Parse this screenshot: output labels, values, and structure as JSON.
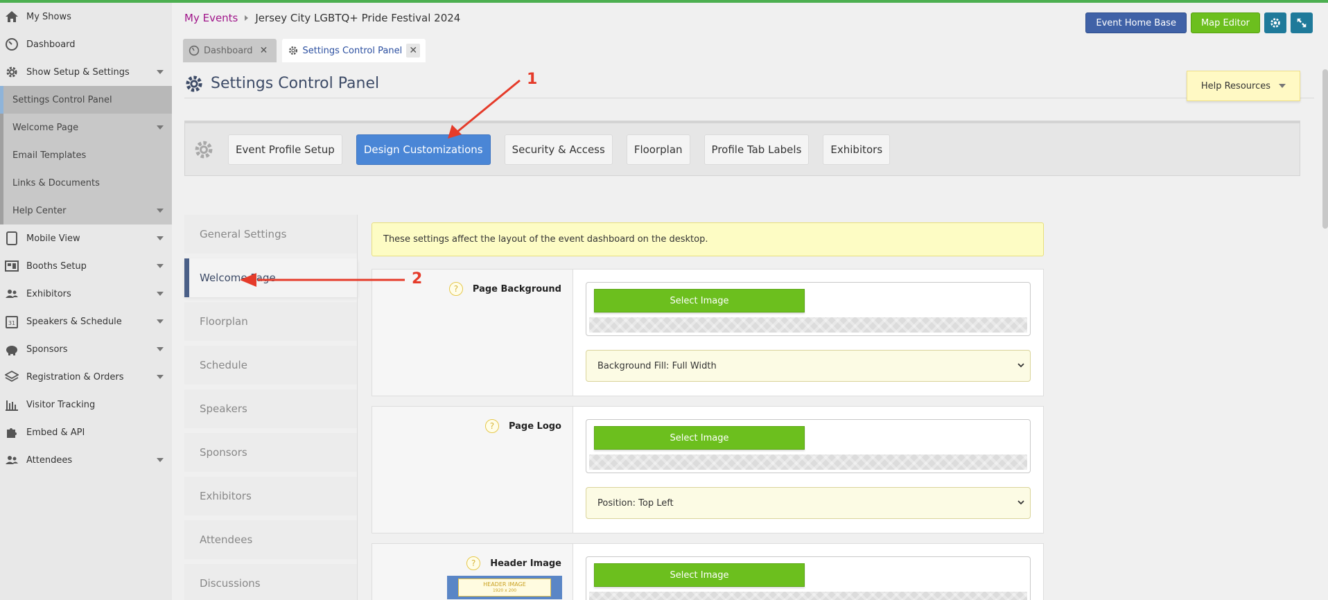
{
  "sidebar": {
    "items": [
      {
        "label": "My Shows",
        "icon": "home-icon"
      },
      {
        "label": "Dashboard",
        "icon": "gauge-icon"
      },
      {
        "label": "Show Setup & Settings",
        "icon": "gear-icon"
      },
      {
        "label": "Mobile View",
        "icon": "tablet-icon"
      },
      {
        "label": "Booths Setup",
        "icon": "layout-icon"
      },
      {
        "label": "Exhibitors",
        "icon": "users-icon"
      },
      {
        "label": "Speakers & Schedule",
        "icon": "calendar-icon"
      },
      {
        "label": "Sponsors",
        "icon": "piggy-bank-icon"
      },
      {
        "label": "Registration & Orders",
        "icon": "layers-icon"
      },
      {
        "label": "Visitor Tracking",
        "icon": "bar-chart-icon"
      },
      {
        "label": "Embed & API",
        "icon": "puzzle-icon"
      },
      {
        "label": "Attendees",
        "icon": "users-icon"
      }
    ],
    "submenu": [
      {
        "label": "Settings Control Panel"
      },
      {
        "label": "Welcome Page"
      },
      {
        "label": "Email Templates"
      },
      {
        "label": "Links & Documents"
      },
      {
        "label": "Help Center"
      }
    ],
    "calendar_day": "31"
  },
  "breadcrumb": {
    "link": "My Events",
    "current": "Jersey City LGBTQ+ Pride Festival 2024"
  },
  "top_buttons": {
    "event_home_base": "Event Home Base",
    "map_editor": "Map Editor"
  },
  "tabs": [
    {
      "label": "Dashboard",
      "close": "✕"
    },
    {
      "label": "Settings Control Panel",
      "close": "✕"
    }
  ],
  "page": {
    "title": "Settings Control Panel",
    "help_resources": "Help Resources"
  },
  "settings_tabs": [
    "Event Profile Setup",
    "Design Customizations",
    "Security & Access",
    "Floorplan",
    "Profile Tab Labels",
    "Exhibitors"
  ],
  "left_nav": [
    "General Settings",
    "Welcome Page",
    "Floorplan",
    "Schedule",
    "Speakers",
    "Sponsors",
    "Exhibitors",
    "Attendees",
    "Discussions"
  ],
  "notice": "These settings affect the layout of the event dashboard on the desktop.",
  "panels": [
    {
      "label": "Page Background",
      "button": "Select Image",
      "select_value": "Background Fill: Full Width"
    },
    {
      "label": "Page Logo",
      "button": "Select Image",
      "select_value": "Position: Top Left"
    },
    {
      "label": "Header Image",
      "button": "Select Image"
    }
  ],
  "header_thumb": {
    "line1": "HEADER IMAGE",
    "line2": "1920 x 200"
  },
  "qmark": "?",
  "annotations": {
    "one": "1",
    "two": "2",
    "color": "#e53b2a"
  }
}
